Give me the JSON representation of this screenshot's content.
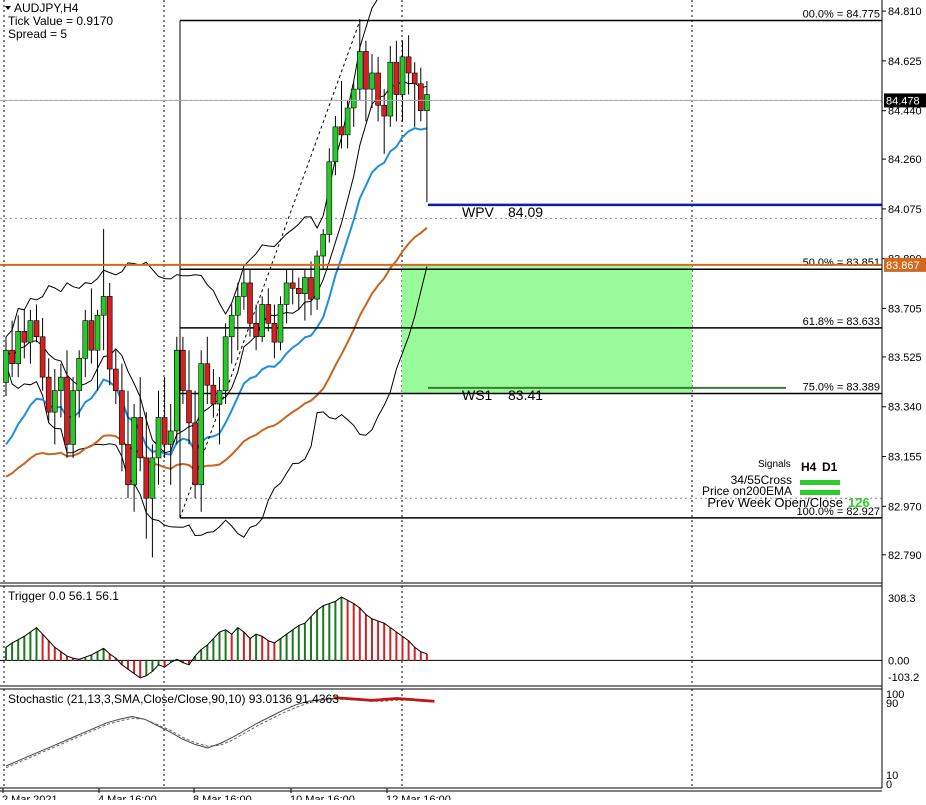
{
  "chart_data": {
    "type": "candlestick",
    "symbol": "AUDJPY,H4",
    "info": {
      "symbol_label": "AUDJPY,H4",
      "tick_value": "Tick Value = 0.9170",
      "spread": "Spread = 5"
    },
    "ylim": [
      82.7,
      84.84
    ],
    "price_ticks": [
      "84.810",
      "84.625",
      "84.440",
      "84.260",
      "84.075",
      "83.890",
      "83.705",
      "83.525",
      "83.340",
      "83.155",
      "82.970",
      "82.790"
    ],
    "current_price": "84.478",
    "current_price_value": 84.478,
    "orange_price": "83.867",
    "orange_price_value": 83.867,
    "x_labels": [
      "2 Mar 2021",
      "4 Mar 16:00",
      "8 Mar 16:00",
      "10 Mar 16:00",
      "12 Mar 16:00"
    ],
    "candles": [
      [
        83.43,
        83.6,
        83.38,
        83.55
      ],
      [
        83.55,
        83.66,
        83.45,
        83.5
      ],
      [
        83.5,
        83.68,
        83.45,
        83.62
      ],
      [
        83.62,
        83.7,
        83.52,
        83.58
      ],
      [
        83.58,
        83.7,
        83.5,
        83.66
      ],
      [
        83.66,
        83.72,
        83.58,
        83.6
      ],
      [
        83.6,
        83.67,
        83.4,
        83.45
      ],
      [
        83.45,
        83.52,
        83.28,
        83.32
      ],
      [
        83.32,
        83.48,
        83.2,
        83.4
      ],
      [
        83.4,
        83.5,
        83.3,
        83.45
      ],
      [
        83.45,
        83.55,
        83.15,
        83.2
      ],
      [
        83.2,
        83.45,
        83.15,
        83.4
      ],
      [
        83.4,
        83.55,
        83.3,
        83.52
      ],
      [
        83.52,
        83.7,
        83.45,
        83.66
      ],
      [
        83.66,
        83.78,
        83.5,
        83.55
      ],
      [
        83.55,
        83.7,
        83.4,
        83.68
      ],
      [
        83.68,
        84.0,
        83.55,
        83.75
      ],
      [
        83.75,
        83.8,
        83.42,
        83.48
      ],
      [
        83.48,
        83.55,
        83.35,
        83.4
      ],
      [
        83.4,
        83.5,
        83.1,
        83.2
      ],
      [
        83.2,
        83.4,
        83.0,
        83.05
      ],
      [
        83.05,
        83.35,
        82.95,
        83.3
      ],
      [
        83.3,
        83.45,
        83.1,
        83.15
      ],
      [
        83.15,
        83.32,
        82.85,
        83.0
      ],
      [
        83.0,
        83.2,
        82.78,
        83.15
      ],
      [
        83.15,
        83.4,
        83.05,
        83.3
      ],
      [
        83.3,
        83.45,
        83.15,
        83.2
      ],
      [
        83.2,
        83.35,
        83.05,
        83.25
      ],
      [
        83.25,
        83.6,
        83.2,
        83.55
      ],
      [
        83.55,
        83.6,
        83.35,
        83.4
      ],
      [
        83.4,
        83.55,
        83.2,
        83.28
      ],
      [
        83.28,
        83.4,
        83.0,
        83.05
      ],
      [
        83.05,
        83.55,
        82.95,
        83.5
      ],
      [
        83.5,
        83.6,
        83.35,
        83.42
      ],
      [
        83.42,
        83.48,
        83.3,
        83.35
      ],
      [
        83.35,
        83.45,
        83.2,
        83.4
      ],
      [
        83.4,
        83.65,
        83.35,
        83.6
      ],
      [
        83.6,
        83.72,
        83.5,
        83.68
      ],
      [
        83.68,
        83.8,
        83.55,
        83.75
      ],
      [
        83.75,
        83.85,
        83.7,
        83.8
      ],
      [
        83.8,
        83.85,
        83.6,
        83.65
      ],
      [
        83.65,
        83.72,
        83.55,
        83.6
      ],
      [
        83.6,
        83.75,
        83.58,
        83.72
      ],
      [
        83.72,
        83.78,
        83.62,
        83.65
      ],
      [
        83.65,
        83.72,
        83.52,
        83.58
      ],
      [
        83.58,
        83.75,
        83.55,
        83.72
      ],
      [
        83.72,
        83.85,
        83.65,
        83.8
      ],
      [
        83.8,
        83.85,
        83.72,
        83.78
      ],
      [
        83.78,
        83.82,
        83.7,
        83.76
      ],
      [
        83.76,
        83.85,
        83.66,
        83.82
      ],
      [
        83.82,
        83.88,
        83.68,
        83.74
      ],
      [
        83.74,
        83.92,
        83.7,
        83.9
      ],
      [
        83.9,
        84.0,
        83.85,
        83.98
      ],
      [
        83.98,
        84.3,
        83.95,
        84.25
      ],
      [
        84.25,
        84.42,
        84.2,
        84.38
      ],
      [
        84.38,
        84.55,
        84.3,
        84.35
      ],
      [
        84.35,
        84.48,
        84.3,
        84.45
      ],
      [
        84.45,
        84.55,
        84.38,
        84.52
      ],
      [
        84.52,
        84.78,
        84.48,
        84.66
      ],
      [
        84.66,
        84.7,
        84.4,
        84.52
      ],
      [
        84.52,
        84.65,
        84.45,
        84.58
      ],
      [
        84.58,
        84.64,
        84.4,
        84.46
      ],
      [
        84.46,
        84.52,
        84.28,
        84.42
      ],
      [
        84.42,
        84.68,
        84.38,
        84.62
      ],
      [
        84.62,
        84.7,
        84.4,
        84.5
      ],
      [
        84.5,
        84.7,
        84.4,
        84.64
      ],
      [
        84.64,
        84.72,
        84.5,
        84.58
      ],
      [
        84.58,
        84.62,
        84.38,
        84.54
      ],
      [
        84.54,
        84.6,
        84.4,
        84.44
      ],
      [
        84.44,
        84.55,
        84.1,
        84.5
      ]
    ],
    "fib_levels": [
      {
        "label": "00.0% = 84.775",
        "value": 84.775
      },
      {
        "label": "50.0% = 83.851",
        "value": 83.851
      },
      {
        "label": "61.8% = 83.633",
        "value": 83.633
      },
      {
        "label": "75.0% = 83.389",
        "value": 83.389
      },
      {
        "label": "100.0% = 82.927",
        "value": 82.927
      }
    ],
    "pivot_levels": [
      {
        "label": "WPV",
        "value_text": "84.09",
        "value": 84.09,
        "color": "#0a1fa8"
      },
      {
        "label": "WS1",
        "value_text": "83.41",
        "value": 83.41,
        "color": "#3a7a3a"
      }
    ],
    "zone": {
      "from": 83.39,
      "to": 83.87,
      "color": "#99fa99"
    },
    "colors": {
      "bull_body": "#28c828",
      "bear_body": "#d42020",
      "ema_blue": "#1e8fe0",
      "ema_orange": "#c8641e",
      "orange_line": "#d2691e",
      "bands": "#000000",
      "signal_green": "#2ecc2e"
    },
    "signals": {
      "title": "Signals",
      "columns": [
        "H4",
        "D1"
      ],
      "rows": [
        "34/55Cross",
        "Price on200EMA",
        "Prev Week Open/Close"
      ],
      "value": "126"
    },
    "trigger": {
      "label": "Trigger 0.0 56.1 56.1",
      "axis_labels": [
        "308.3",
        "0.00",
        "-103.2"
      ],
      "ylim": [
        -103.2,
        308.3
      ],
      "values": [
        60,
        80,
        95,
        110,
        130,
        150,
        120,
        90,
        60,
        40,
        20,
        10,
        5,
        15,
        25,
        40,
        55,
        30,
        10,
        -20,
        -40,
        -60,
        -80,
        -70,
        -50,
        -20,
        -30,
        -10,
        5,
        -10,
        -20,
        20,
        50,
        70,
        100,
        130,
        140,
        120,
        150,
        130,
        100,
        120,
        110,
        90,
        80,
        100,
        120,
        140,
        160,
        170,
        200,
        230,
        250,
        260,
        270,
        290,
        275,
        260,
        240,
        210,
        190,
        180,
        170,
        150,
        130,
        110,
        90,
        60,
        40,
        30
      ]
    },
    "stochastic": {
      "label": "Stochastic (21,13,3,SMA,Close/Close,90,10) 93.0136 91.4363",
      "axis_labels": [
        "100",
        "90",
        "10",
        "0"
      ],
      "ylim": [
        0,
        100
      ],
      "main": [
        20,
        26,
        32,
        38,
        44,
        50,
        56,
        62,
        68,
        72,
        75,
        72,
        65,
        58,
        50,
        44,
        40,
        45,
        52,
        60,
        68,
        75,
        82,
        88,
        92,
        94,
        95,
        94,
        93,
        92,
        93,
        94,
        93,
        92,
        91
      ],
      "signal": [
        18,
        24,
        30,
        36,
        42,
        48,
        54,
        60,
        66,
        70,
        73,
        72,
        66,
        60,
        52,
        46,
        42,
        43,
        49,
        57,
        65,
        72,
        79,
        85,
        90,
        93,
        94,
        94,
        93,
        92,
        92,
        93,
        93,
        92,
        91
      ]
    }
  }
}
